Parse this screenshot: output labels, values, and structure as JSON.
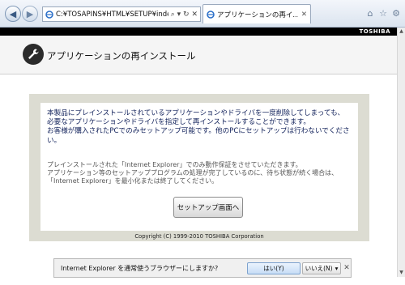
{
  "browser": {
    "address": "C:¥TOSAPINS¥HTML¥SETUP¥index_top.ht",
    "address_controls": "⌕ ▾ ↻ ✕",
    "tab_title": "アプリケーションの再イ...",
    "icons": [
      "back-icon",
      "forward-icon",
      "home-icon",
      "star-icon",
      "gear-icon"
    ]
  },
  "brand": {
    "logo": "TOSHIBA"
  },
  "header": {
    "title": "アプリケーションの再インストール"
  },
  "content": {
    "main_lines": [
      "本製品にプレインストールされているアプリケーションやドライバを一度削除してしまっても、",
      "必要なアプリケーションやドライバを指定して再インストールすることができます。",
      "お客様が購入されたPCでのみセットアップ可能です。他のPCにセットアップは行わないでください。"
    ],
    "sub_lines": [
      "プレインストールされた「Internet Explorer」でのみ動作保証をさせていただきます。",
      "アプリケーション等のセットアッププログラムの処理が完了しているのに、待ち状態が続く場合は、「Internet Explorer」を最小化または終了してください。"
    ],
    "setup_button": "セットアップ画面へ",
    "copyright": "Copyright (C) 1999-2010 TOSHIBA Corporation"
  },
  "notification": {
    "text": "Internet Explorer を通常使うブラウザーにしますか?",
    "yes": "はい(Y)",
    "no": "いいえ(N)",
    "no_arrow": "▾",
    "close": "✕"
  },
  "colors": {
    "accent_text": "#10205a",
    "panel_bg": "#dcdcd2",
    "header_band": "#000000"
  }
}
